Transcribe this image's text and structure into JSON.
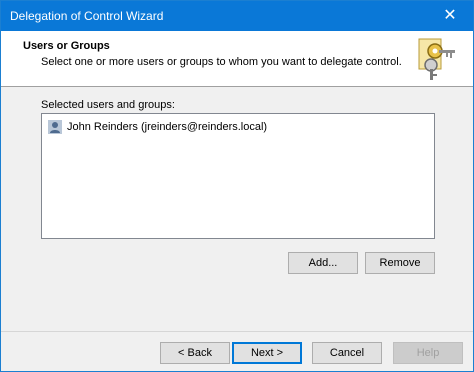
{
  "window": {
    "title": "Delegation of Control Wizard"
  },
  "titlebar": {
    "close_glyph": "✕"
  },
  "header": {
    "title": "Users or Groups",
    "subtitle": "Select one or more users or groups to whom you want to delegate control.",
    "icon": "keys-icon"
  },
  "selected": {
    "label": "Selected users and groups:",
    "items": [
      {
        "name": "John Reinders (jreinders@reinders.local)",
        "icon": "user-icon"
      }
    ]
  },
  "buttons": {
    "add": "Add...",
    "remove": "Remove",
    "back": "< Back",
    "next": "Next >",
    "cancel": "Cancel",
    "help": "Help"
  },
  "colors": {
    "titlebar": "#0a78d7",
    "dialog_bg": "#f0f0f0",
    "accent": "#0078d7"
  }
}
